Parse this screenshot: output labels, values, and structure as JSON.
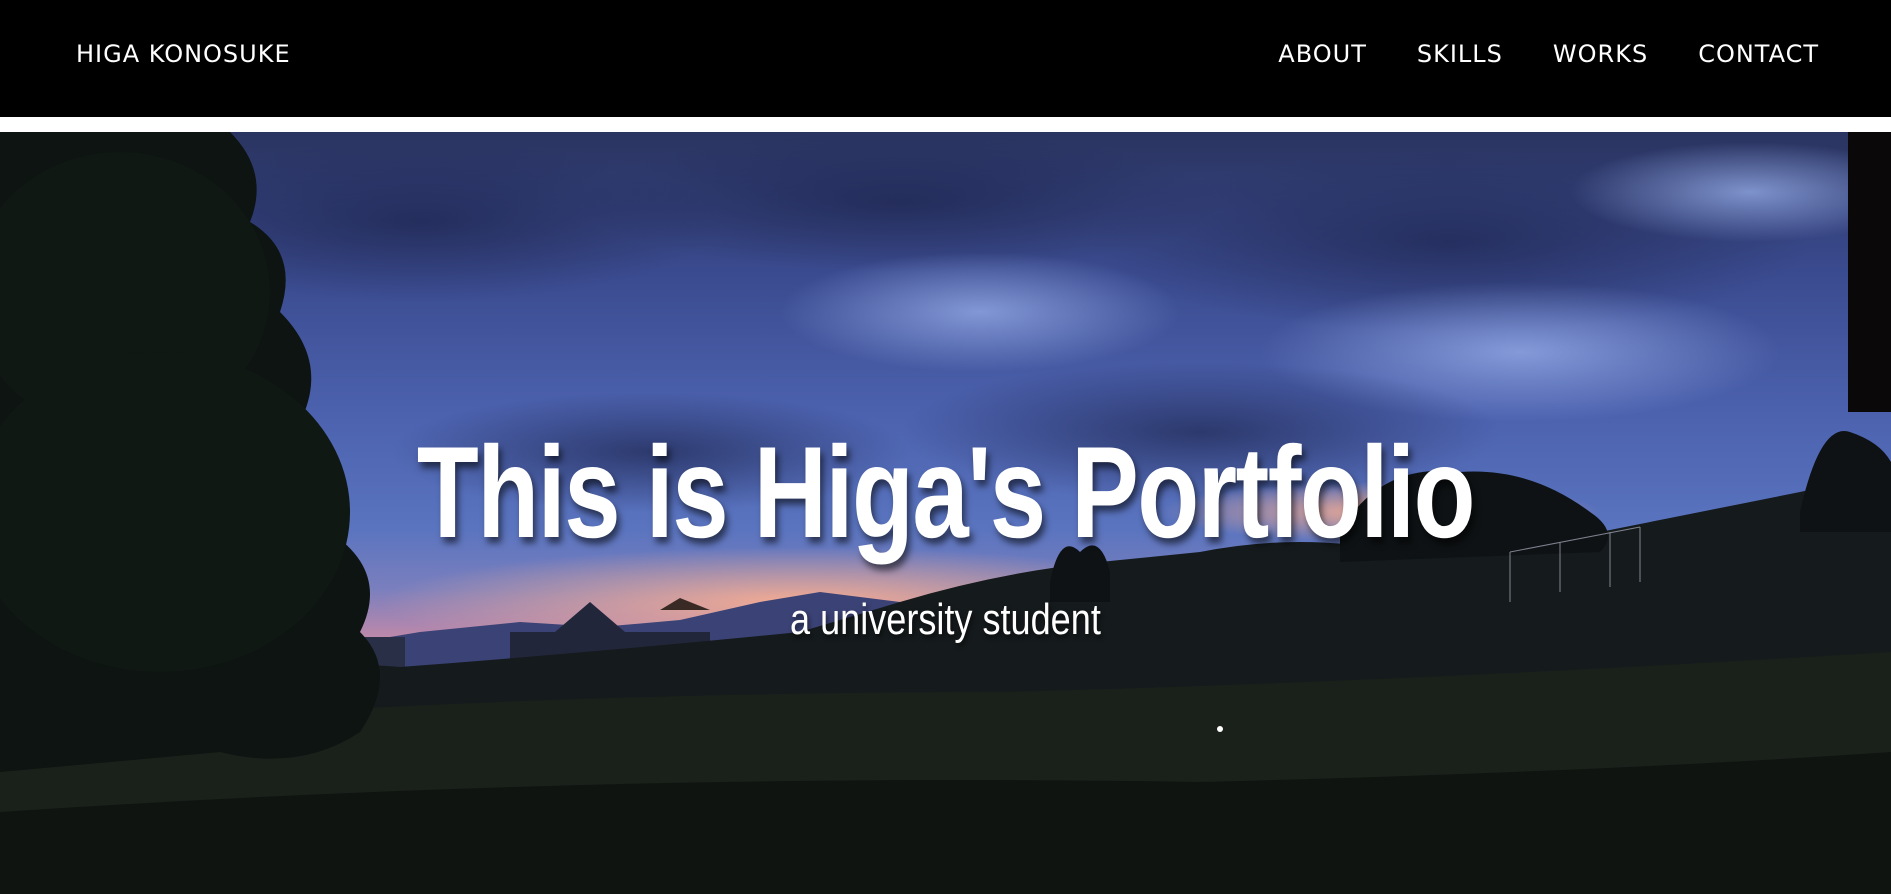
{
  "header": {
    "brand": "HIGA KONOSUKE",
    "nav": [
      {
        "label": "ABOUT"
      },
      {
        "label": "SKILLS"
      },
      {
        "label": "WORKS"
      },
      {
        "label": "CONTACT"
      }
    ]
  },
  "hero": {
    "title": "This is Higa's Portfolio",
    "subtitle": "a university student"
  },
  "colors": {
    "header_bg": "#000000",
    "text": "#ffffff"
  }
}
